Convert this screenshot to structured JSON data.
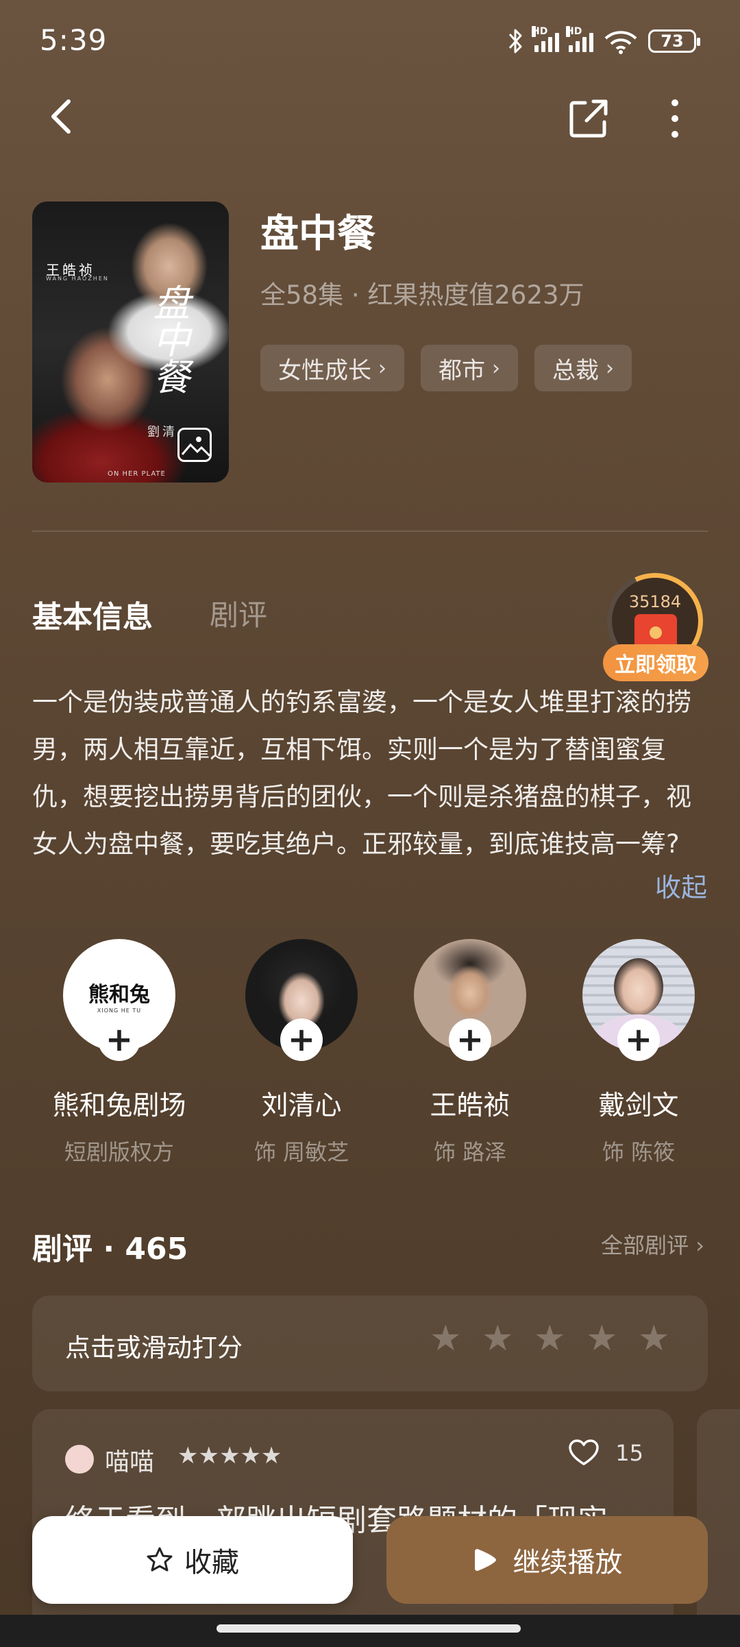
{
  "status_bar": {
    "time": "5:39",
    "battery": "73"
  },
  "show": {
    "title": "盘中餐",
    "meta": "全58集 · 红果热度值2623万",
    "tags": [
      "女性成长",
      "都市",
      "总裁"
    ],
    "poster": {
      "actor_cn": "王皓祯",
      "actor_en": "WANG HAOZHEN",
      "title_cn": "盘中餐",
      "actress_cn": "劉清",
      "english_title": "ON HER PLATE"
    }
  },
  "tabs": {
    "active": "基本信息",
    "inactive": "剧评"
  },
  "red_packet": {
    "count": "35184",
    "label": "立即领取"
  },
  "synopsis": "一个是伪装成普通人的钓系富婆，一个是女人堆里打滚的捞男，两人相互靠近，互相下饵。实则一个是为了替闺蜜复仇，想要挖出捞男背后的团伙，一个则是杀猪盘的棋子，视女人为盘中餐，要吃其绝户。正邪较量，到底谁技高一筹?",
  "collapse_label": "收起",
  "cast": [
    {
      "name": "熊和兔剧场",
      "role": "短剧版权方",
      "avatar_text": "熊和兔",
      "avatar_sub": "XIONG HE TU"
    },
    {
      "name": "刘清心",
      "role": "饰 周敏芝"
    },
    {
      "name": "王皓祯",
      "role": "饰 路泽"
    },
    {
      "name": "戴剑文",
      "role": "饰 陈筱"
    }
  ],
  "reviews": {
    "title": "剧评 · 465",
    "all_label": "全部剧评",
    "rate_prompt": "点击或滑动打分",
    "rating_max": 5,
    "first": {
      "user": "喵喵",
      "stars": "★★★★★",
      "likes": "15",
      "text": "终于看到一部跳出短剧套路题材的「现实"
    }
  },
  "bottom": {
    "favorite": "收藏",
    "play": "继续播放"
  },
  "colors": {
    "accent_play": "#8d6640",
    "link_blue": "#9bb4de",
    "red_packet_orange": "#f29340"
  }
}
